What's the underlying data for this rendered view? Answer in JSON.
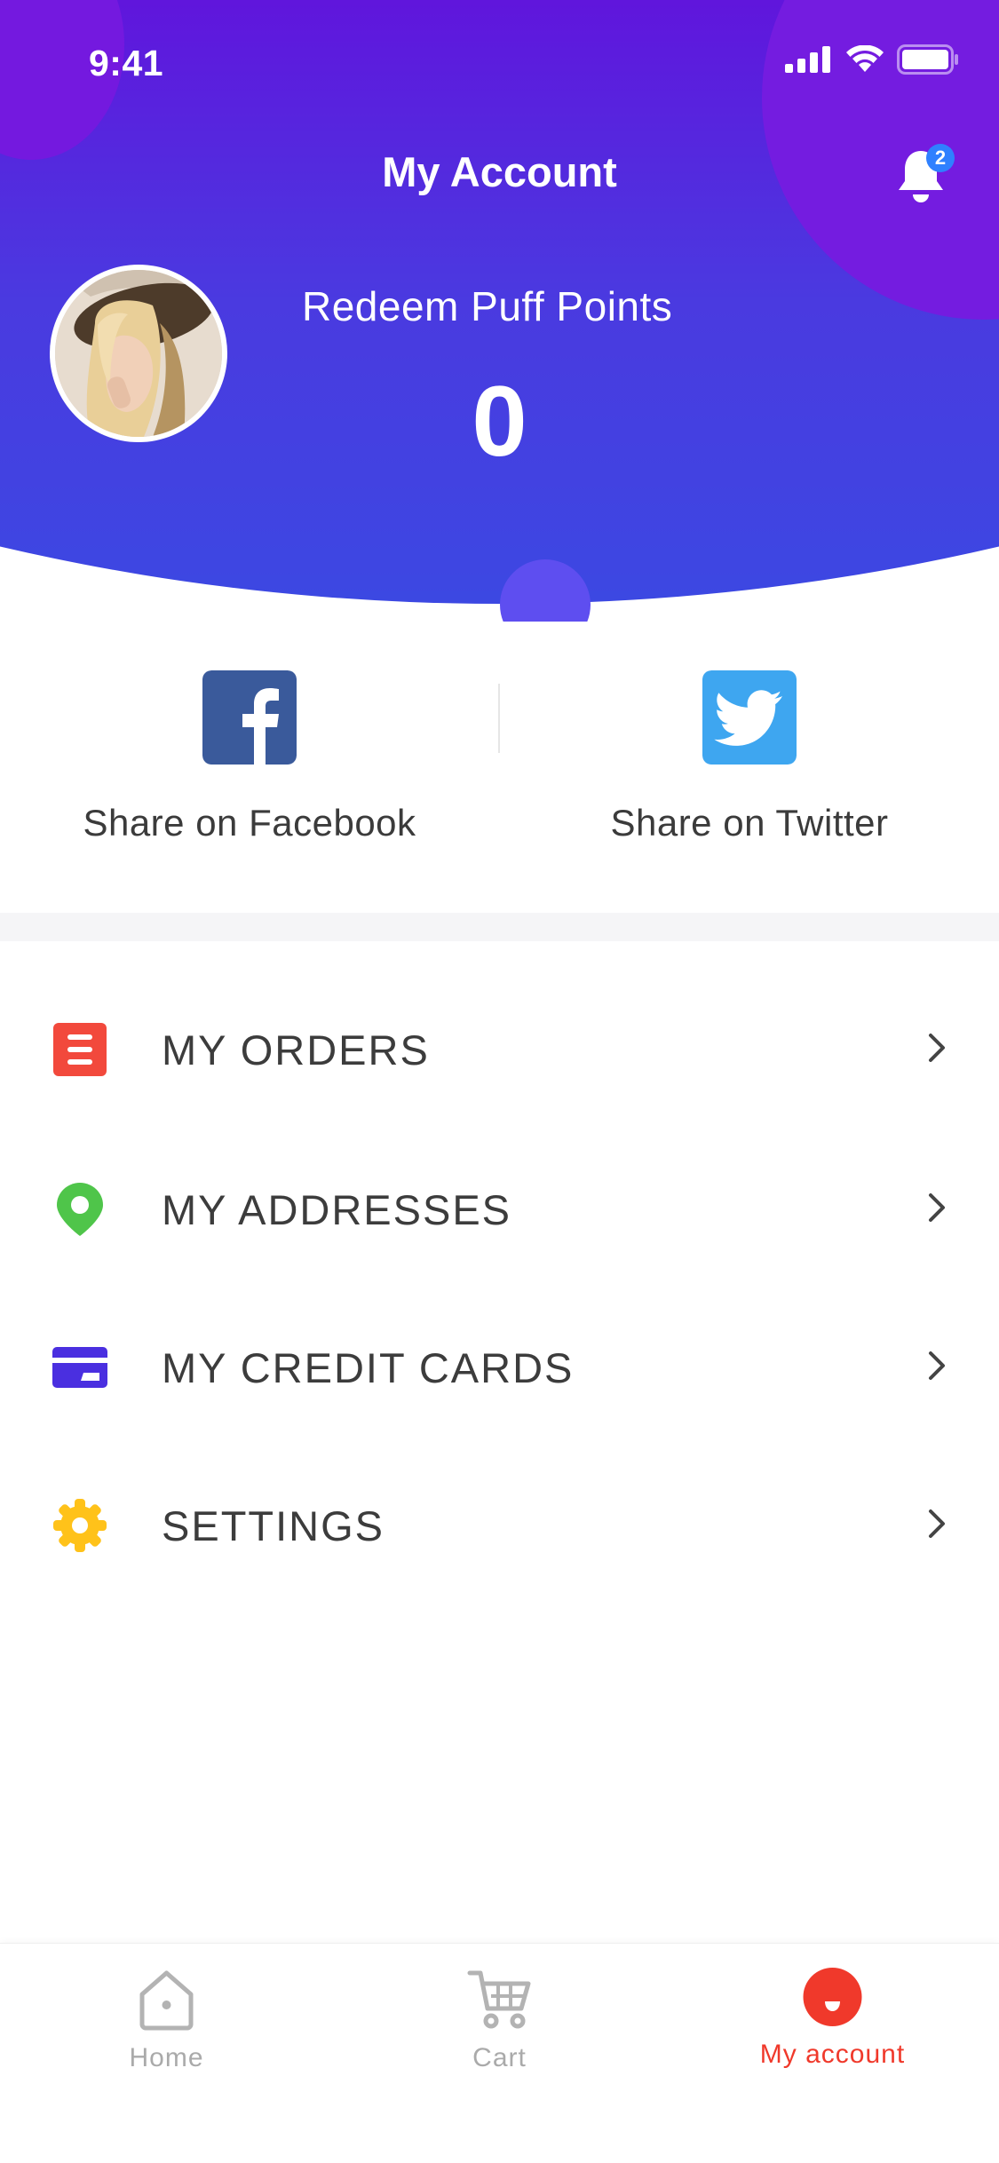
{
  "status_bar": {
    "time": "9:41"
  },
  "header": {
    "title": "My Account",
    "notification_count": "2",
    "points_label": "Redeem Puff Points",
    "points_value": "0"
  },
  "share": {
    "facebook_label": "Share on Facebook",
    "twitter_label": "Share on Twitter"
  },
  "menu": {
    "items": [
      {
        "label": "MY ORDERS",
        "icon": "orders-icon",
        "color": "#f2493c"
      },
      {
        "label": "MY ADDRESSES",
        "icon": "location-pin-icon",
        "color": "#4fc54a"
      },
      {
        "label": "MY CREDIT CARDS",
        "icon": "credit-card-icon",
        "color": "#4a2fe0"
      },
      {
        "label": "SETTINGS",
        "icon": "gear-icon",
        "color": "#ffc21a"
      }
    ]
  },
  "tabbar": {
    "items": [
      {
        "label": "Home",
        "icon": "home-icon",
        "active": false
      },
      {
        "label": "Cart",
        "icon": "cart-icon",
        "active": false
      },
      {
        "label": "My account",
        "icon": "account-icon",
        "active": true
      }
    ]
  },
  "colors": {
    "header_gradient_top": "#6212dc",
    "header_gradient_bottom": "#3c48e2",
    "facebook": "#3a5a9b",
    "twitter": "#3ea6f0",
    "active_tab": "#f0392b",
    "inactive_tab": "#aaaaaa",
    "badge": "#2f80ff"
  }
}
